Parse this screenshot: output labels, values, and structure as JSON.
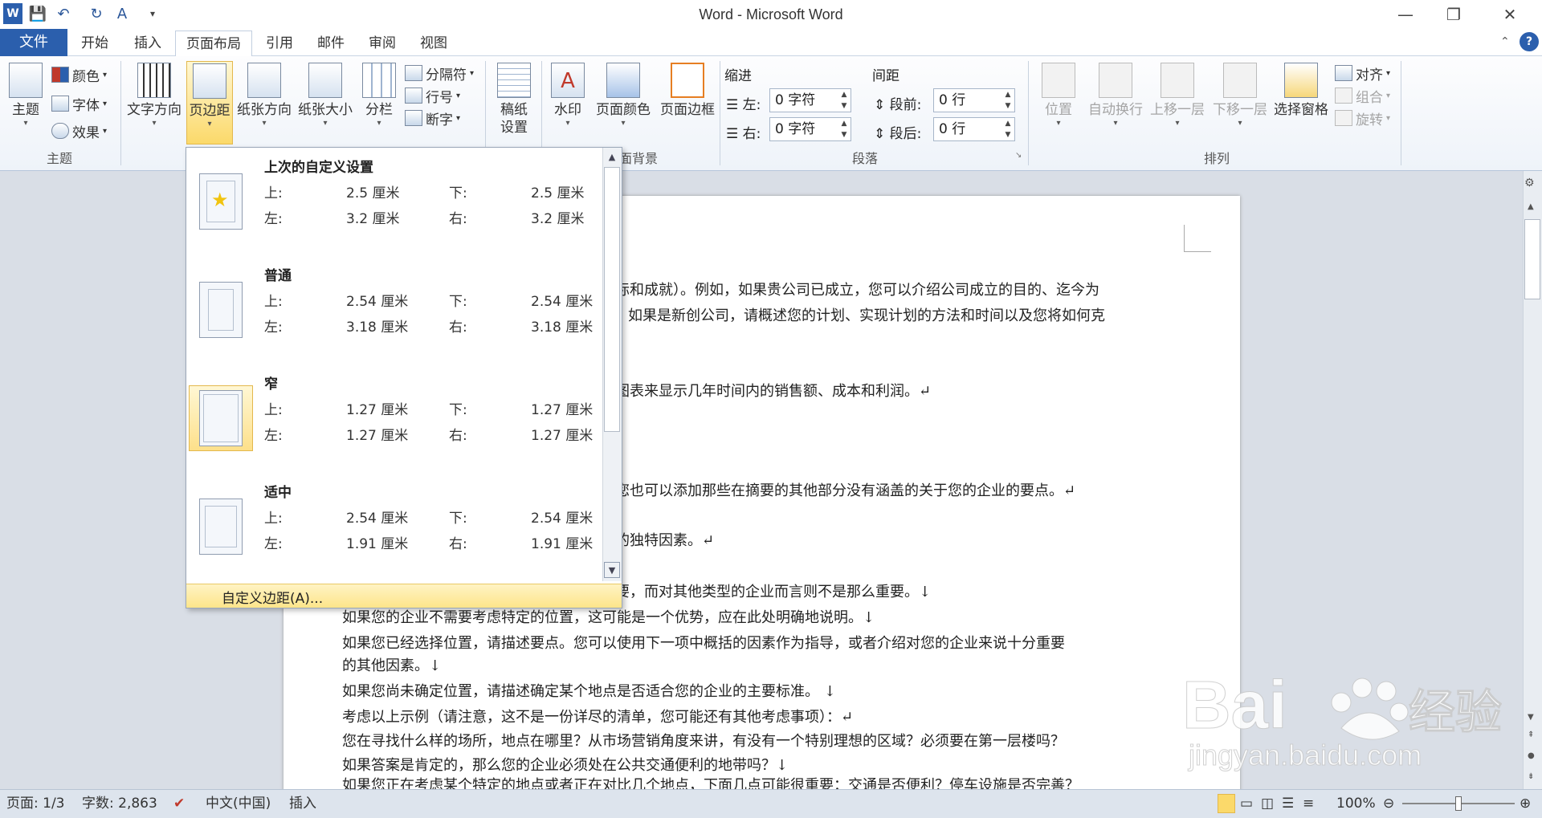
{
  "window": {
    "title": "Word - Microsoft Word"
  },
  "qat": {
    "word_icon": "W"
  },
  "tabs": [
    "文件",
    "开始",
    "插入",
    "页面布局",
    "引用",
    "邮件",
    "审阅",
    "视图"
  ],
  "ribbon": {
    "theme_group": {
      "label": "主题",
      "themes": "主题",
      "colors": "颜色",
      "fonts": "字体",
      "effects": "效果"
    },
    "page_setup": {
      "text_direction": "文字方向",
      "margins": "页边距",
      "orientation": "纸张方向",
      "size": "纸张大小",
      "columns": "分栏",
      "breaks": "分隔符",
      "line_numbers": "行号",
      "hyphenation": "断字"
    },
    "manuscript": {
      "label1": "稿纸",
      "label2": "设置"
    },
    "page_bg": {
      "watermark": "水印",
      "page_color": "页面颜色",
      "page_borders": "页面边框",
      "label": "面背景"
    },
    "paragraph": {
      "indent_title": "缩进",
      "spacing_title": "间距",
      "left": "左:",
      "right": "右:",
      "left_value": "0 字符",
      "right_value": "0 字符",
      "before": "段前:",
      "after": "段后:",
      "before_value": "0 行",
      "after_value": "0 行",
      "label": "段落"
    },
    "arrange": {
      "position": "位置",
      "wrap": "自动换行",
      "bring_forward": "上移一层",
      "send_backward": "下移一层",
      "selection_pane": "选择窗格",
      "align": "对齐",
      "group": "组合",
      "rotate": "旋转",
      "label": "排列"
    }
  },
  "margins_menu": {
    "items": [
      {
        "title": "上次的自定义设置",
        "top_label": "上:",
        "top": "2.5 厘米",
        "bottom_label": "下:",
        "bottom": "2.5 厘米",
        "left_label": "左:",
        "left": "3.2 厘米",
        "right_label": "右:",
        "right": "3.2 厘米"
      },
      {
        "title": "普通",
        "top_label": "上:",
        "top": "2.54 厘米",
        "bottom_label": "下:",
        "bottom": "2.54 厘米",
        "left_label": "左:",
        "left": "3.18 厘米",
        "right_label": "右:",
        "right": "3.18 厘米"
      },
      {
        "title": "窄",
        "top_label": "上:",
        "top": "1.27 厘米",
        "bottom_label": "下:",
        "bottom": "1.27 厘米",
        "left_label": "左:",
        "left": "1.27 厘米",
        "right_label": "右:",
        "right": "1.27 厘米"
      },
      {
        "title": "适中",
        "top_label": "上:",
        "top": "2.54 厘米",
        "bottom_label": "下:",
        "bottom": "2.54 厘米",
        "left_label": "左:",
        "left": "1.91 厘米",
        "right_label": "右:",
        "right": "1.91 厘米"
      }
    ],
    "custom": "自定义边距(A)..."
  },
  "document": {
    "lines": [
      "际和成就）。例如，如果贵公司已成立，您可以介绍公司成立的目的、迄今为",
      "如果是新创公司，请概述您的计划、实现计划的方法和时间以及您将如何克",
      "图表来显示几年时间内的销售额、成本和利润。↵",
      "您也可以添加那些在摘要的其他部分没有涵盖的关于您的企业的要点。↵",
      "的独特因素。↵",
      "要，而对其他类型的企业而言则不是那么重要。↓",
      "如果您的企业不需要考虑特定的位置，这可能是一个优势，应在此处明确地说明。↓",
      "如果您已经选择位置，请描述要点。您可以使用下一项中概括的因素作为指导，或者介绍对您的企业来说十分重要",
      "的其他因素。↓",
      "如果您尚未确定位置，请描述确定某个地点是否适合您的企业的主要标准。 ↓",
      "考虑以上示例（请注意，这不是一份详尽的清单，您可能还有其他考虑事项）：↵",
      "您在寻找什么样的场所，地点在哪里？从市场营销角度来讲，有没有一个特别理想的区域？必须要在第一层楼吗？",
      "如果答案是肯定的，那么您的企业必须处在公共交通便利的地带吗？↓",
      "如果您正在考虑某个特定的地点或者正在对比几个地点，下面几点可能很重要：交通是否便利？停车设施是否完善？"
    ]
  },
  "status": {
    "page": "页面: 1/3",
    "words": "字数: 2,863",
    "language": "中文(中国)",
    "mode": "插入",
    "zoom": "100%"
  },
  "watermark": {
    "brand": "Bai",
    "brand2": "经验",
    "url": "jingyan.baidu.com"
  },
  "colors": {
    "accent": "#2b5fad",
    "hover": "#fde58a"
  }
}
